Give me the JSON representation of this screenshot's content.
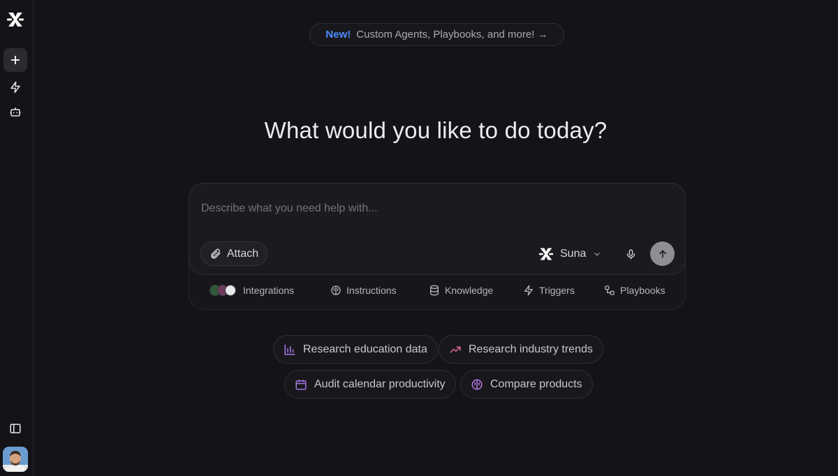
{
  "announcement": {
    "badge": "New!",
    "text": "Custom Agents, Playbooks, and more! →"
  },
  "heading": "What would you like to do today?",
  "composer": {
    "placeholder": "Describe what you need help with...",
    "attach_label": "Attach",
    "agent_name": "Suna"
  },
  "toolbar": {
    "integrations": "Integrations",
    "instructions": "Instructions",
    "knowledge": "Knowledge",
    "triggers": "Triggers",
    "playbooks": "Playbooks"
  },
  "suggestions": [
    {
      "label": "Research education data",
      "icon": "bar-chart-icon",
      "color": "#a477e6"
    },
    {
      "label": "Research industry trends",
      "icon": "trend-up-icon",
      "color": "#e565a0"
    },
    {
      "label": "Audit calendar productivity",
      "icon": "calendar-icon",
      "color": "#a477e6"
    },
    {
      "label": "Compare products",
      "icon": "brain-icon",
      "color": "#b77ce8"
    }
  ],
  "colors": {
    "background": "#141418",
    "accent_new": "#4d8dff",
    "send_button": "#8e8e94"
  }
}
